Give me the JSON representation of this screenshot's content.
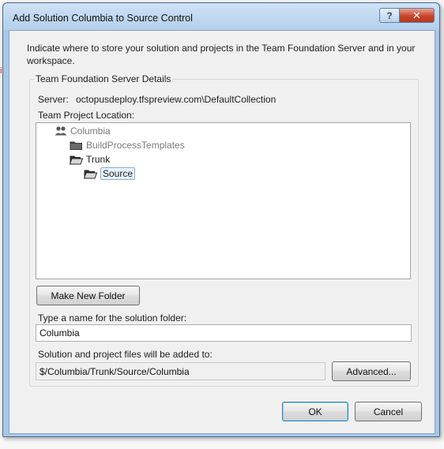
{
  "window": {
    "title": "Add Solution Columbia to Source Control",
    "help_glyph": "?",
    "close_glyph": "✕"
  },
  "stray_glyph": "i",
  "intro_text": "Indicate where to store your solution and projects in the Team Foundation Server and in your workspace.",
  "details": {
    "legend": "Team Foundation Server Details",
    "server_label": "Server:",
    "server_value": "octopusdeploy.tfspreview.com\\DefaultCollection",
    "location_label": "Team Project Location:"
  },
  "tree": {
    "items": [
      {
        "label": "Columbia",
        "icon": "team-project-icon"
      },
      {
        "label": "BuildProcessTemplates",
        "icon": "folder-icon"
      },
      {
        "label": "Trunk",
        "icon": "folder-open-icon"
      },
      {
        "label": "Source",
        "icon": "folder-open-icon",
        "selected": true
      }
    ]
  },
  "buttons": {
    "make_new_folder": "Make New Folder",
    "advanced": "Advanced...",
    "ok": "OK",
    "cancel": "Cancel"
  },
  "solution_folder": {
    "label": "Type a name for the solution folder:",
    "value": "Columbia"
  },
  "destination": {
    "label": "Solution and project files will be added to:",
    "value": "$/Columbia/Trunk/Source/Columbia"
  }
}
